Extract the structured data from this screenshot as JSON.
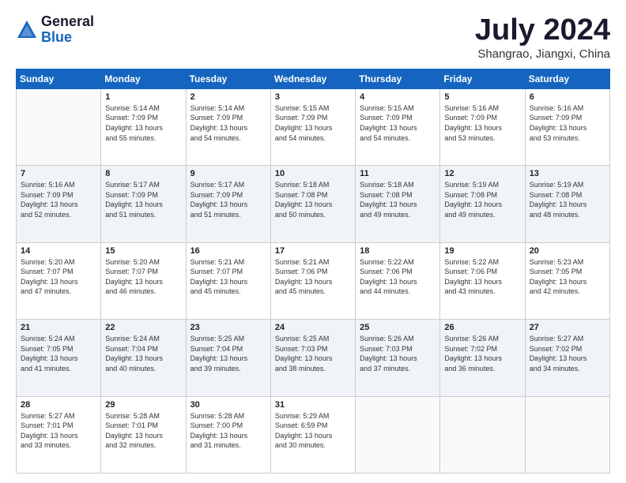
{
  "logo": {
    "general": "General",
    "blue": "Blue"
  },
  "header": {
    "month": "July 2024",
    "location": "Shangrao, Jiangxi, China"
  },
  "weekdays": [
    "Sunday",
    "Monday",
    "Tuesday",
    "Wednesday",
    "Thursday",
    "Friday",
    "Saturday"
  ],
  "weeks": [
    [
      {
        "day": null,
        "info": null
      },
      {
        "day": "1",
        "info": "Sunrise: 5:14 AM\nSunset: 7:09 PM\nDaylight: 13 hours\nand 55 minutes."
      },
      {
        "day": "2",
        "info": "Sunrise: 5:14 AM\nSunset: 7:09 PM\nDaylight: 13 hours\nand 54 minutes."
      },
      {
        "day": "3",
        "info": "Sunrise: 5:15 AM\nSunset: 7:09 PM\nDaylight: 13 hours\nand 54 minutes."
      },
      {
        "day": "4",
        "info": "Sunrise: 5:15 AM\nSunset: 7:09 PM\nDaylight: 13 hours\nand 54 minutes."
      },
      {
        "day": "5",
        "info": "Sunrise: 5:16 AM\nSunset: 7:09 PM\nDaylight: 13 hours\nand 53 minutes."
      },
      {
        "day": "6",
        "info": "Sunrise: 5:16 AM\nSunset: 7:09 PM\nDaylight: 13 hours\nand 53 minutes."
      }
    ],
    [
      {
        "day": "7",
        "info": "Sunrise: 5:16 AM\nSunset: 7:09 PM\nDaylight: 13 hours\nand 52 minutes."
      },
      {
        "day": "8",
        "info": "Sunrise: 5:17 AM\nSunset: 7:09 PM\nDaylight: 13 hours\nand 51 minutes."
      },
      {
        "day": "9",
        "info": "Sunrise: 5:17 AM\nSunset: 7:09 PM\nDaylight: 13 hours\nand 51 minutes."
      },
      {
        "day": "10",
        "info": "Sunrise: 5:18 AM\nSunset: 7:08 PM\nDaylight: 13 hours\nand 50 minutes."
      },
      {
        "day": "11",
        "info": "Sunrise: 5:18 AM\nSunset: 7:08 PM\nDaylight: 13 hours\nand 49 minutes."
      },
      {
        "day": "12",
        "info": "Sunrise: 5:19 AM\nSunset: 7:08 PM\nDaylight: 13 hours\nand 49 minutes."
      },
      {
        "day": "13",
        "info": "Sunrise: 5:19 AM\nSunset: 7:08 PM\nDaylight: 13 hours\nand 48 minutes."
      }
    ],
    [
      {
        "day": "14",
        "info": "Sunrise: 5:20 AM\nSunset: 7:07 PM\nDaylight: 13 hours\nand 47 minutes."
      },
      {
        "day": "15",
        "info": "Sunrise: 5:20 AM\nSunset: 7:07 PM\nDaylight: 13 hours\nand 46 minutes."
      },
      {
        "day": "16",
        "info": "Sunrise: 5:21 AM\nSunset: 7:07 PM\nDaylight: 13 hours\nand 45 minutes."
      },
      {
        "day": "17",
        "info": "Sunrise: 5:21 AM\nSunset: 7:06 PM\nDaylight: 13 hours\nand 45 minutes."
      },
      {
        "day": "18",
        "info": "Sunrise: 5:22 AM\nSunset: 7:06 PM\nDaylight: 13 hours\nand 44 minutes."
      },
      {
        "day": "19",
        "info": "Sunrise: 5:22 AM\nSunset: 7:06 PM\nDaylight: 13 hours\nand 43 minutes."
      },
      {
        "day": "20",
        "info": "Sunrise: 5:23 AM\nSunset: 7:05 PM\nDaylight: 13 hours\nand 42 minutes."
      }
    ],
    [
      {
        "day": "21",
        "info": "Sunrise: 5:24 AM\nSunset: 7:05 PM\nDaylight: 13 hours\nand 41 minutes."
      },
      {
        "day": "22",
        "info": "Sunrise: 5:24 AM\nSunset: 7:04 PM\nDaylight: 13 hours\nand 40 minutes."
      },
      {
        "day": "23",
        "info": "Sunrise: 5:25 AM\nSunset: 7:04 PM\nDaylight: 13 hours\nand 39 minutes."
      },
      {
        "day": "24",
        "info": "Sunrise: 5:25 AM\nSunset: 7:03 PM\nDaylight: 13 hours\nand 38 minutes."
      },
      {
        "day": "25",
        "info": "Sunrise: 5:26 AM\nSunset: 7:03 PM\nDaylight: 13 hours\nand 37 minutes."
      },
      {
        "day": "26",
        "info": "Sunrise: 5:26 AM\nSunset: 7:02 PM\nDaylight: 13 hours\nand 36 minutes."
      },
      {
        "day": "27",
        "info": "Sunrise: 5:27 AM\nSunset: 7:02 PM\nDaylight: 13 hours\nand 34 minutes."
      }
    ],
    [
      {
        "day": "28",
        "info": "Sunrise: 5:27 AM\nSunset: 7:01 PM\nDaylight: 13 hours\nand 33 minutes."
      },
      {
        "day": "29",
        "info": "Sunrise: 5:28 AM\nSunset: 7:01 PM\nDaylight: 13 hours\nand 32 minutes."
      },
      {
        "day": "30",
        "info": "Sunrise: 5:28 AM\nSunset: 7:00 PM\nDaylight: 13 hours\nand 31 minutes."
      },
      {
        "day": "31",
        "info": "Sunrise: 5:29 AM\nSunset: 6:59 PM\nDaylight: 13 hours\nand 30 minutes."
      },
      {
        "day": null,
        "info": null
      },
      {
        "day": null,
        "info": null
      },
      {
        "day": null,
        "info": null
      }
    ]
  ]
}
